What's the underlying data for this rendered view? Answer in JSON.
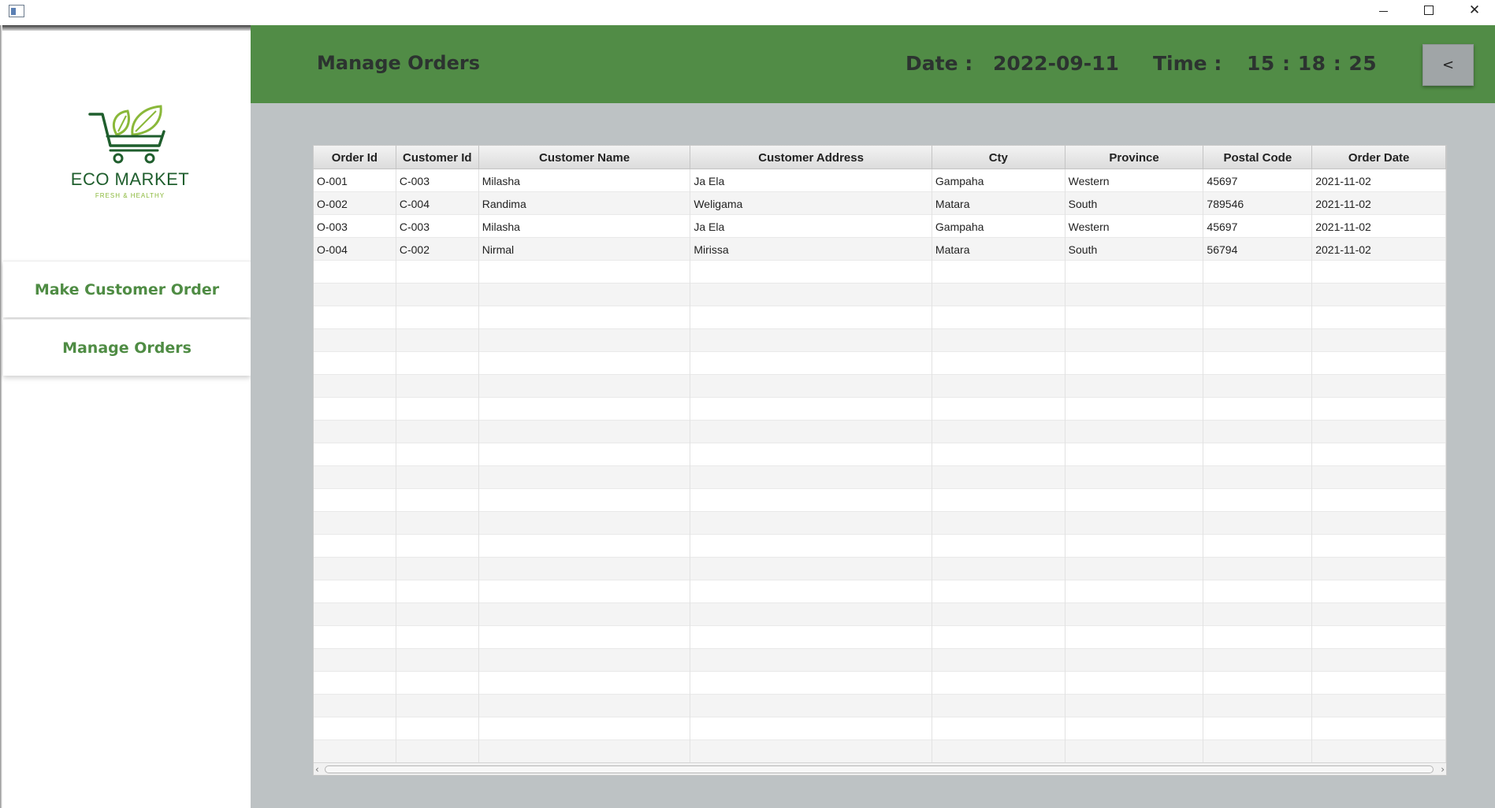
{
  "window": {
    "icon": "app-window-icon",
    "controls": {
      "minimize": "minimize-icon",
      "maximize": "maximize-icon",
      "close": "✕"
    }
  },
  "sidebar": {
    "logo": {
      "title": "ECO MARKET",
      "tagline": "FRESH & HEALTHY",
      "icon": "cart-leaf-icon",
      "colors": {
        "dark": "#1f5e2d",
        "light": "#8ab83a"
      }
    },
    "items": [
      {
        "label": "Make Customer Order"
      },
      {
        "label": "Manage Orders"
      }
    ]
  },
  "header": {
    "title": "Manage Orders",
    "date_label": "Date :",
    "date_value": "2022-09-11",
    "time_label": "Time :",
    "time_value": "15 : 18 : 25",
    "back_label": "<",
    "color": "#518c46"
  },
  "table": {
    "columns": [
      "Order Id",
      "Customer Id",
      "Customer Name",
      "Customer Address",
      "Cty",
      "Province",
      "Postal Code",
      "Order Date"
    ],
    "rows": [
      [
        "O-001",
        "C-003",
        "Milasha",
        "Ja Ela",
        "Gampaha",
        "Western",
        "45697",
        "2021-11-02"
      ],
      [
        "O-002",
        "C-004",
        "Randima",
        "Weligama",
        "Matara",
        "South",
        "789546",
        "2021-11-02"
      ],
      [
        "O-003",
        "C-003",
        "Milasha",
        "Ja Ela",
        "Gampaha",
        "Western",
        "45697",
        "2021-11-02"
      ],
      [
        "O-004",
        "C-002",
        "Nirmal",
        "Mirissa",
        "Matara",
        "South",
        "56794",
        "2021-11-02"
      ]
    ]
  },
  "colors": {
    "content_bg": "#bdc2c4",
    "accent_text": "#4f8c44"
  }
}
